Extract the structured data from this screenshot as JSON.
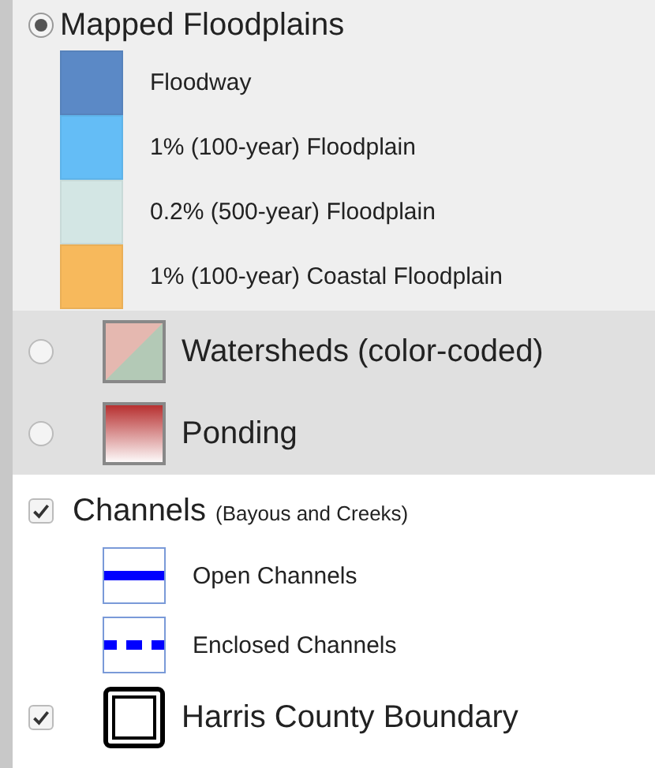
{
  "layers": [
    {
      "kind": "radio",
      "selected": true,
      "label": "Mapped Floodplains",
      "legend": [
        {
          "label": "Floodway",
          "color": "#5b89c6"
        },
        {
          "label": "1% (100-year) Floodplain",
          "color": "#64bdf6"
        },
        {
          "label": "0.2% (500-year) Floodplain",
          "color": "#d3e6e4"
        },
        {
          "label": "1% (100-year) Coastal Floodplain",
          "color": "#f7b95c"
        }
      ]
    },
    {
      "kind": "radio",
      "selected": false,
      "label": "Watersheds (color-coded)",
      "swatch": {
        "kind": "split"
      }
    },
    {
      "kind": "radio",
      "selected": false,
      "label": "Ponding",
      "swatch": {
        "kind": "gradient"
      }
    },
    {
      "kind": "checkbox",
      "checked": true,
      "label": "Channels",
      "note": "(Bayous and Creeks)",
      "lines": [
        {
          "label": "Open Channels",
          "kind": "solid"
        },
        {
          "label": "Enclosed Channels",
          "kind": "dashed"
        }
      ]
    },
    {
      "kind": "checkbox",
      "checked": true,
      "label": "Harris County Boundary",
      "swatch": {
        "kind": "boundary"
      }
    }
  ]
}
